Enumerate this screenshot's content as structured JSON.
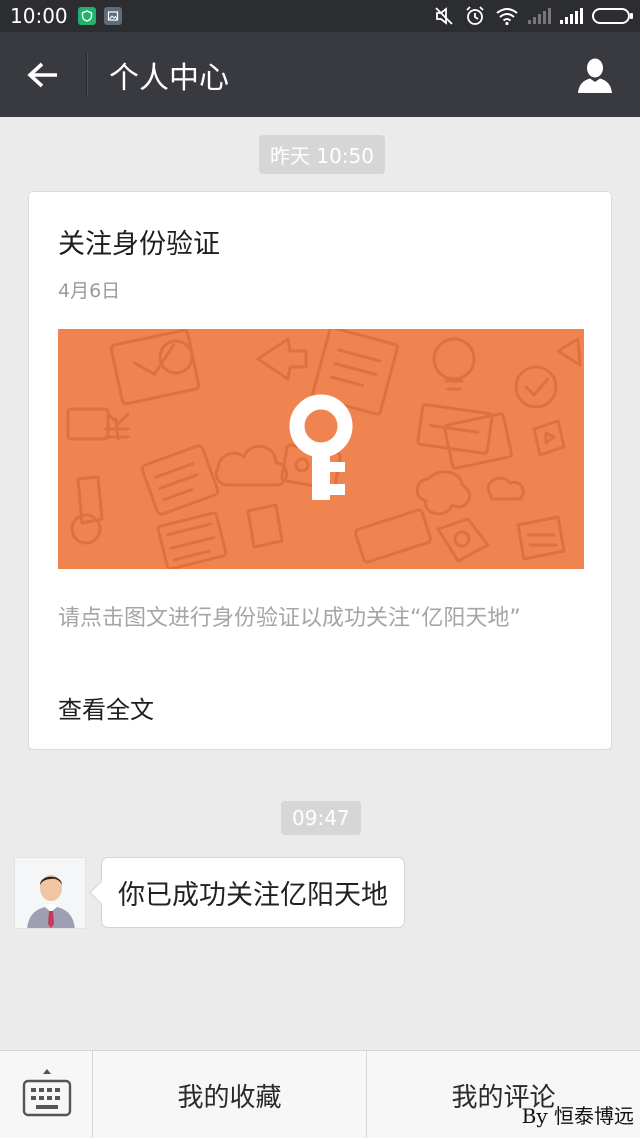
{
  "status_bar": {
    "time": "10:00",
    "icons": [
      "shield-notification-icon",
      "gallery-notification-icon",
      "mute-icon",
      "alarm-icon",
      "wifi-icon",
      "signal-icon",
      "signal-icon",
      "battery-icon"
    ]
  },
  "header": {
    "title": "个人中心",
    "back_icon": "arrow-left-icon",
    "profile_icon": "person-icon"
  },
  "messages": {
    "first_timestamp": "昨天 10:50",
    "article": {
      "title": "关注身份验证",
      "date": "4月6日",
      "image_icon": "key-icon",
      "description": "请点击图文进行身份验证以成功关注“亿阳天地”",
      "read_more": "查看全文"
    },
    "second_timestamp": "09:47",
    "chat_text": "你已成功关注亿阳天地"
  },
  "bottom_menu": {
    "keyboard_icon": "keyboard-icon",
    "items": [
      "我的收藏",
      "我的评论"
    ]
  },
  "watermark": "By 恒泰博远",
  "colors": {
    "status_bar": "#2c2d31",
    "title_bar": "#393a3f",
    "background": "#ebebeb",
    "banner": "#ef8451"
  }
}
